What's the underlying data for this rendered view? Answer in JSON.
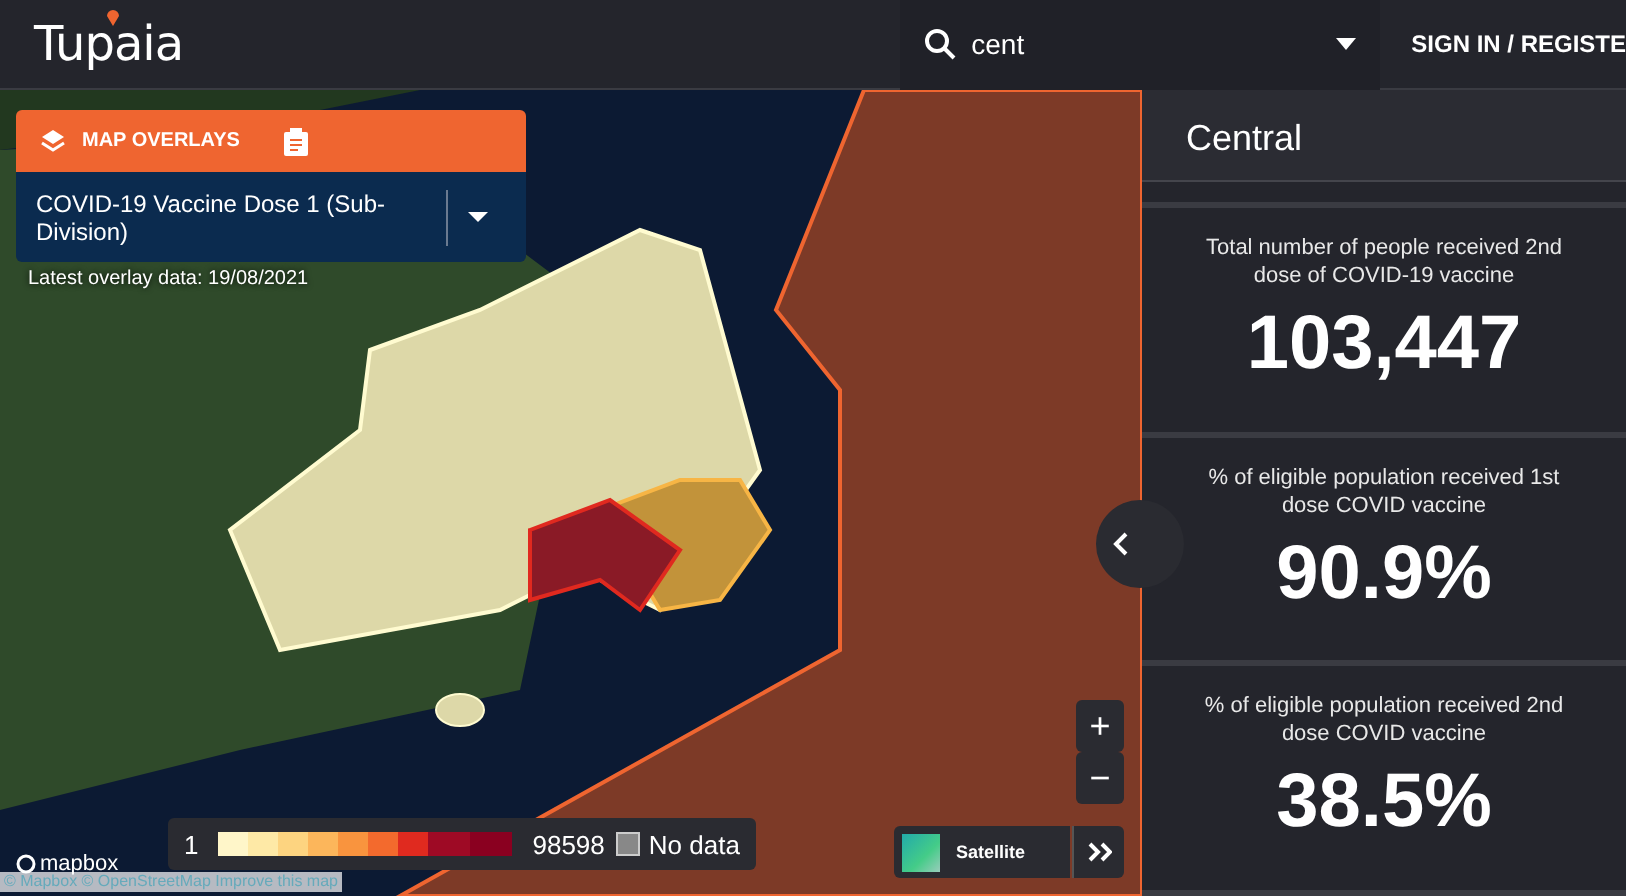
{
  "header": {
    "logo": "Tupaia",
    "search": {
      "value": "cent"
    },
    "sign_in": "SIGN IN / REGISTE"
  },
  "overlay_panel": {
    "title": "MAP OVERLAYS",
    "selected_overlay": "COVID-19 Vaccine Dose 1 (Sub-Division)",
    "latest_data": "Latest overlay data: 19/08/2021"
  },
  "legend": {
    "min": "1",
    "max": "98598",
    "swatches": [
      {
        "color": "#fff6c9"
      },
      {
        "color": "#fee9a6"
      },
      {
        "color": "#fdd480"
      },
      {
        "color": "#fcb65b"
      },
      {
        "color": "#f9943e"
      },
      {
        "color": "#f36a2d"
      },
      {
        "color": "#e02a1f"
      },
      {
        "color": "#9e0a25"
      },
      {
        "color": "#8a0020"
      }
    ],
    "no_data": {
      "label": "No data",
      "checked": false
    }
  },
  "map_style": {
    "label": "Satellite"
  },
  "zoom_controls": [
    "+",
    "−"
  ],
  "attribution": {
    "logo": "mapbox",
    "text": "© Mapbox © OpenStreetMap Improve this map"
  },
  "side_panel": {
    "title": "Central",
    "stats": [
      {
        "label": "Total number of people received 2nd dose of COVID-19 vaccine",
        "value": "103,447"
      },
      {
        "label": "% of eligible population received 1st dose COVID vaccine",
        "value": "90.9%"
      },
      {
        "label": "% of eligible population received 2nd dose COVID vaccine",
        "value": "38.5%"
      }
    ]
  }
}
